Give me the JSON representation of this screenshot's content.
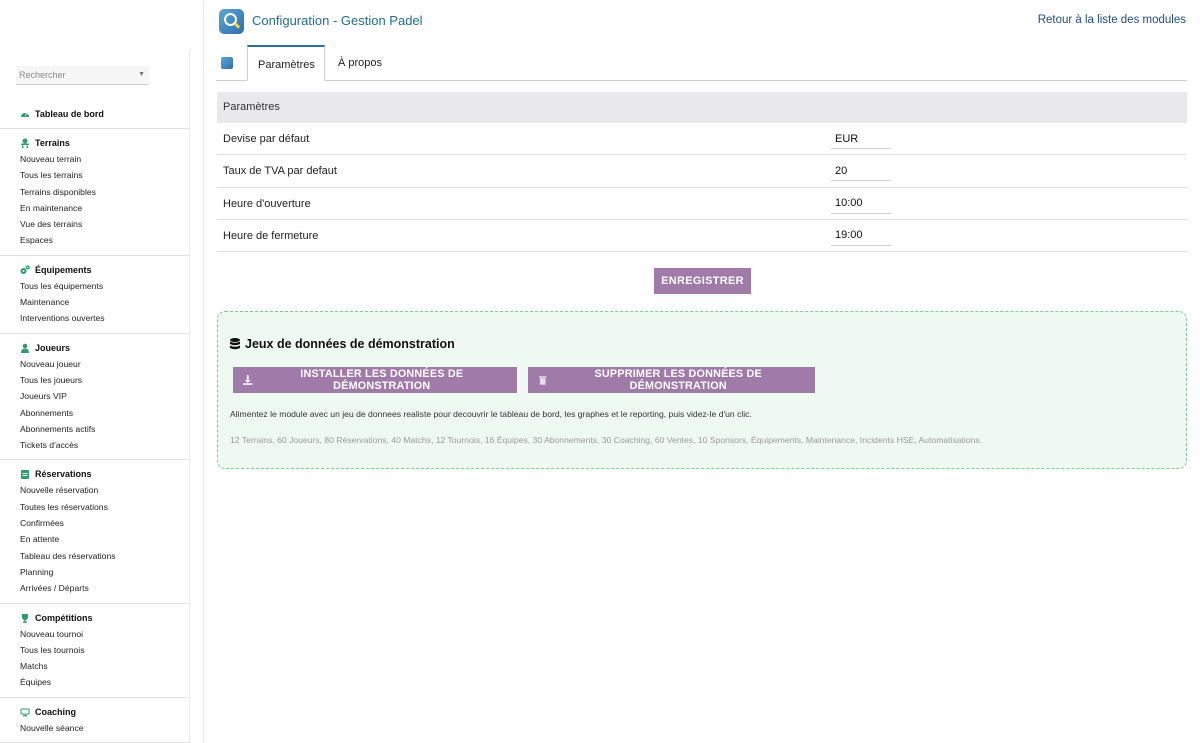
{
  "header": {
    "title": "Configuration - Gestion Padel",
    "back_link": "Retour à la liste des modules"
  },
  "sidebar": {
    "search_placeholder": "Rechercher",
    "sections": [
      {
        "title": "Tableau de bord",
        "icon": "dashboard-icon",
        "items": []
      },
      {
        "title": "Terrains",
        "icon": "court-icon",
        "items": [
          "Nouveau terrain",
          "Tous les terrains",
          "Terrains disponibles",
          "En maintenance",
          "Vue des terrains",
          "Espaces"
        ]
      },
      {
        "title": "Équipements",
        "icon": "equipment-icon",
        "items": [
          "Tous les équipements",
          "Maintenance",
          "Interventions ouvertes"
        ]
      },
      {
        "title": "Joueurs",
        "icon": "player-icon",
        "items": [
          "Nouveau joueur",
          "Tous les joueurs",
          "Joueurs VIP",
          "Abonnements",
          "Abonnements actifs",
          "Tickets d'accès"
        ]
      },
      {
        "title": "Réservations",
        "icon": "calendar-icon",
        "items": [
          "Nouvelle réservation",
          "Toutes les réservations",
          "Confirmées",
          "En attente",
          "Tableau des réservations",
          "Planning",
          "Arrivées / Départs"
        ]
      },
      {
        "title": "Compétitions",
        "icon": "trophy-icon",
        "items": [
          "Nouveau tournoi",
          "Tous les tournois",
          "Matchs",
          "Équipes"
        ]
      },
      {
        "title": "Coaching",
        "icon": "coaching-icon",
        "items": [
          "Nouvelle séance"
        ]
      }
    ]
  },
  "tabs": {
    "params": "Paramètres",
    "about": "À propos"
  },
  "params": {
    "heading": "Paramètres",
    "rows": [
      {
        "label": "Devise par défaut",
        "value": "EUR"
      },
      {
        "label": "Taux de TVA par defaut",
        "value": "20"
      },
      {
        "label": "Heure d'ouverture",
        "value": "10:00"
      },
      {
        "label": "Heure de fermeture",
        "value": "19:00"
      }
    ],
    "save_label": "ENREGISTRER"
  },
  "demo": {
    "title": "Jeux de données de démonstration",
    "install_label": "INSTALLER LES DONNÉES DE DÉMONSTRATION",
    "delete_label": "SUPPRIMER LES DONNÉES DE DÉMONSTRATION",
    "description": "Alimentez le module avec un jeu de donnees realiste pour decouvrir le tableau de bord, les graphes et le reporting, puis videz-le d'un clic.",
    "stats": "12 Terrains, 60 Joueurs, 80 Réservations, 40 Matchs, 12 Tournois, 16 Équipes, 30 Abonnements, 30 Coaching, 60 Ventes, 10 Sponsors, Équipements, Maintenance, Incidents HSE, Automatisations."
  },
  "colors": {
    "accent": "#a07aa8",
    "link": "#1f6f8b",
    "icon_green": "#2e9d6b",
    "demo_border": "#7ccc8e",
    "demo_bg": "#eefaf1"
  }
}
